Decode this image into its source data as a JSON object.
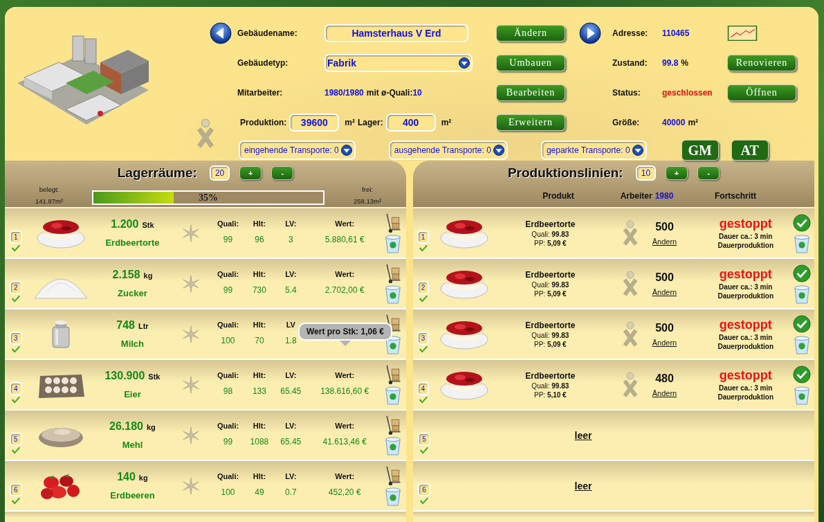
{
  "building": {
    "name_label": "Gebäudename:",
    "name": "Hamsterhaus V Erd",
    "change_button": "Ändern",
    "type_label": "Gebäudetyp:",
    "type": "Fabrik",
    "rebuild_button": "Umbauen",
    "workers_label": "Mitarbeiter:",
    "workers": "1980/1980",
    "workers_mid": "mit ø-Quali:",
    "workers_quali": "10",
    "edit_button": "Bearbeiten",
    "production_label": "Produktion:",
    "production": "39600",
    "production_unit": "m²",
    "storage_label": "Lager:",
    "storage": "400",
    "storage_unit": "m²",
    "expand_button": "Erweitern",
    "address_label": "Adresse:",
    "address": "110465",
    "condition_label": "Zustand:",
    "condition": "99.8",
    "condition_unit": "%",
    "renovate_button": "Renovieren",
    "status_label": "Status:",
    "status": "geschlossen",
    "open_button": "Öffnen",
    "size_label": "Größe:",
    "size": "40000",
    "size_unit": "m²"
  },
  "transports": [
    "eingehende Transporte: 0",
    "ausgehende Transporte: 0",
    "geparkte Transporte: 0"
  ],
  "mode_buttons": [
    "GM",
    "AT"
  ],
  "storage": {
    "title": "Lagerräume:",
    "count": "20",
    "plus": "+",
    "minus": "-",
    "used_label": "belegt:",
    "used": "141.87m²",
    "level": 0.35,
    "level_text": "35%",
    "free_label": "frei:",
    "free": "258.13m²",
    "items": [
      {
        "slot": "1",
        "amount": "1.200",
        "unit": "Stk",
        "name": "Erdbeertorte",
        "quali_label": "Quali:",
        "quali": "99",
        "hlt_label": "Hlt:",
        "hlt": "96",
        "lv_label": "LV:",
        "lv": "3",
        "wert_label": "Wert:",
        "wert": "5.880,61 €"
      },
      {
        "slot": "2",
        "amount": "2.158",
        "unit": "kg",
        "name": "Zucker",
        "quali_label": "Quali:",
        "quali": "99",
        "hlt_label": "Hlt:",
        "hlt": "730",
        "lv_label": "LV:",
        "lv": "5.4",
        "wert_label": "Wert:",
        "wert": "2.702,00 €"
      },
      {
        "slot": "3",
        "amount": "748",
        "unit": "Ltr",
        "name": "Milch",
        "quali_label": "Quali:",
        "quali": "100",
        "hlt_label": "Hlt:",
        "hlt": "70",
        "lv_label": "LV",
        "lv": "1.8",
        "tooltip": "Wert pro Stk: 1,06 €"
      },
      {
        "slot": "4",
        "amount": "130.900",
        "unit": "Stk",
        "name": "Eier",
        "quali_label": "Quali:",
        "quali": "98",
        "hlt_label": "Hlt:",
        "hlt": "133",
        "lv_label": "LV:",
        "lv": "65.45",
        "wert_label": "Wert:",
        "wert": "138.616,60 €"
      },
      {
        "slot": "5",
        "amount": "26.180",
        "unit": "kg",
        "name": "Mehl",
        "quali_label": "Quali:",
        "quali": "99",
        "hlt_label": "Hlt:",
        "hlt": "1088",
        "lv_label": "LV:",
        "lv": "65.45",
        "wert_label": "Wert:",
        "wert": "41.613,46 €"
      },
      {
        "slot": "6",
        "amount": "140",
        "unit": "kg",
        "name": "Erdbeeren",
        "quali_label": "Quali:",
        "quali": "100",
        "hlt_label": "Hlt:",
        "hlt": "49",
        "lv_label": "LV:",
        "lv": "0.7",
        "wert_label": "Wert:",
        "wert": "452,20 €"
      }
    ]
  },
  "production": {
    "title": "Produktionslinien:",
    "count": "10",
    "plus": "+",
    "minus": "-",
    "col_product": "Produkt",
    "col_workers": "Arbeiter",
    "col_workers_count": "1980",
    "col_progress": "Fortschritt",
    "lines": [
      {
        "kind": "product",
        "slot": "1",
        "product": "Erdbeertorte",
        "quali_label": "Quali:",
        "quali": "99.83",
        "pp_label": "PP:",
        "pp": "5,09 €",
        "workers": "500",
        "change": "Ändern",
        "state": "gestoppt",
        "duration": "Dauer ca.: 3 min",
        "mode": "Dauerproduktion"
      },
      {
        "kind": "product",
        "slot": "2",
        "product": "Erdbeertorte",
        "quali_label": "Quali:",
        "quali": "99.83",
        "pp_label": "PP:",
        "pp": "5,09 €",
        "workers": "500",
        "change": "Ändern",
        "state": "gestoppt",
        "duration": "Dauer ca.: 3 min",
        "mode": "Dauerproduktion"
      },
      {
        "kind": "product",
        "slot": "3",
        "product": "Erdbeertorte",
        "quali_label": "Quali:",
        "quali": "99.83",
        "pp_label": "PP:",
        "pp": "5,09 €",
        "workers": "500",
        "change": "Ändern",
        "state": "gestoppt",
        "duration": "Dauer ca.: 3 min",
        "mode": "Dauerproduktion"
      },
      {
        "kind": "product",
        "slot": "4",
        "product": "Erdbeertorte",
        "quali_label": "Quali:",
        "quali": "99.83",
        "pp_label": "PP:",
        "pp": "5,10 €",
        "workers": "480",
        "change": "Ändern",
        "state": "gestoppt",
        "duration": "Dauer ca.: 3 min",
        "mode": "Dauerproduktion"
      },
      {
        "kind": "empty",
        "slot": "5",
        "label": "leer"
      },
      {
        "kind": "empty",
        "slot": "6",
        "label": "leer"
      }
    ]
  }
}
